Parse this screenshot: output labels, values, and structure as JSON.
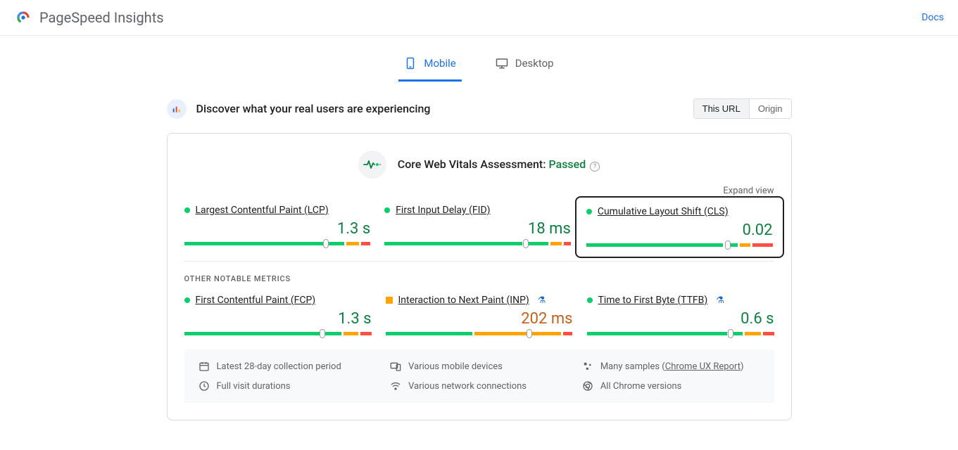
{
  "header": {
    "title": "PageSpeed Insights",
    "docs": "Docs"
  },
  "tabs": {
    "mobile": "Mobile",
    "desktop": "Desktop"
  },
  "section": {
    "title": "Discover what your real users are experiencing",
    "this_url": "This URL",
    "origin": "Origin"
  },
  "assessment": {
    "label": "Core Web Vitals Assessment:",
    "status": "Passed",
    "expand": "Expand view"
  },
  "metrics": {
    "lcp": {
      "name": "Largest Contentful Paint (LCP)",
      "value": "1.3 s"
    },
    "fid": {
      "name": "First Input Delay (FID)",
      "value": "18 ms"
    },
    "cls": {
      "name": "Cumulative Layout Shift (CLS)",
      "value": "0.02"
    },
    "fcp": {
      "name": "First Contentful Paint (FCP)",
      "value": "1.3 s"
    },
    "inp": {
      "name": "Interaction to Next Paint (INP)",
      "value": "202 ms"
    },
    "ttfb": {
      "name": "Time to First Byte (TTFB)",
      "value": "0.6 s"
    }
  },
  "other_label": "OTHER NOTABLE METRICS",
  "footer": {
    "period": "Latest 28-day collection period",
    "devices": "Various mobile devices",
    "samples_prefix": "Many samples (",
    "samples_link": "Chrome UX Report",
    "samples_suffix": ")",
    "durations": "Full visit durations",
    "network": "Various network connections",
    "versions": "All Chrome versions"
  }
}
